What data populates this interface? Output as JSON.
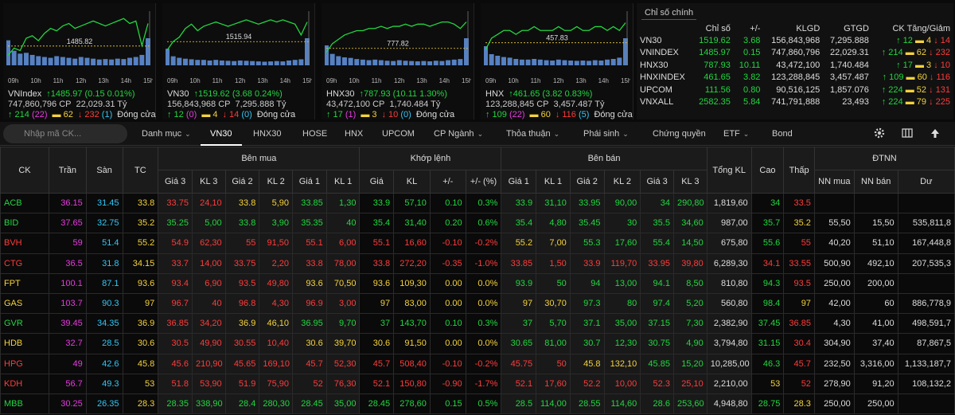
{
  "colors": {
    "up": "#22d640",
    "down": "#ff3b3b",
    "ref": "#f4d23c",
    "ceil": "#e63be0",
    "floor": "#34c6f4"
  },
  "charts": [
    {
      "name": "VNIndex",
      "ref_value": "1485.82",
      "times": [
        "09h",
        "10h",
        "11h",
        "12h",
        "13h",
        "14h",
        "15h"
      ],
      "line": [
        1482,
        1485,
        1484,
        1489,
        1490,
        1488,
        1491,
        1493,
        1492,
        1494,
        1495,
        1493,
        1494,
        1495,
        1496,
        1495,
        1494,
        1495,
        1496,
        1497,
        1495,
        1496,
        1486,
        1495
      ],
      "volume": [
        60,
        35,
        28,
        30,
        25,
        22,
        20,
        18,
        22,
        20,
        18,
        16,
        20,
        18,
        16,
        14,
        15,
        14,
        16,
        15,
        18,
        20,
        25,
        65
      ],
      "ylim": [
        1478,
        1500
      ],
      "value": "1485.97",
      "change": "(0.15 0.01%)",
      "dir": "up",
      "vol": "747,860,796 CP",
      "val": "22,029.31 Tỷ",
      "adv": "214",
      "adv_c": "(22)",
      "unch": "62",
      "dec": "232",
      "dec_f": "(1)",
      "status": "Đóng cửa"
    },
    {
      "name": "VN30",
      "ref_value": "1515.94",
      "times": [
        "09h",
        "10h",
        "11h",
        "12h",
        "13h",
        "14h",
        "15h"
      ],
      "line": [
        1512,
        1516,
        1518,
        1522,
        1524,
        1521,
        1523,
        1524,
        1525,
        1524,
        1523,
        1524,
        1525,
        1526,
        1525,
        1524,
        1525,
        1526,
        1525,
        1526,
        1525,
        1524,
        1519,
        1525
      ],
      "volume": [
        55,
        30,
        25,
        22,
        20,
        18,
        18,
        16,
        18,
        16,
        15,
        14,
        16,
        15,
        14,
        13,
        12,
        13,
        14,
        13,
        16,
        18,
        20,
        90
      ],
      "ylim": [
        1505,
        1530
      ],
      "value": "1519.62",
      "change": "(3.68 0.24%)",
      "dir": "up",
      "vol": "156,843,968 CP",
      "val": "7,295.888 Tỷ",
      "adv": "12",
      "adv_c": "(0)",
      "unch": "4",
      "dec": "14",
      "dec_f": "(0)",
      "status": "Đóng cửa"
    },
    {
      "name": "HNX30",
      "ref_value": "777.82",
      "times": [
        "09h",
        "10h",
        "11h",
        "12h",
        "13h",
        "14h",
        "15h"
      ],
      "line": [
        776,
        780,
        782,
        784,
        785,
        786,
        786,
        787,
        787,
        788,
        787,
        788,
        788,
        789,
        788,
        789,
        789,
        788,
        789,
        790,
        790,
        789,
        787,
        790
      ],
      "volume": [
        70,
        40,
        32,
        28,
        26,
        22,
        20,
        18,
        20,
        18,
        16,
        15,
        18,
        16,
        15,
        14,
        15,
        14,
        16,
        15,
        18,
        20,
        22,
        95
      ],
      "ylim": [
        770,
        795
      ],
      "value": "787.93",
      "change": "(10.11 1.30%)",
      "dir": "up",
      "vol": "43,472,100 CP",
      "val": "1,740.484 Tỷ",
      "adv": "17",
      "adv_c": "(1)",
      "unch": "3",
      "dec": "10",
      "dec_f": "(0)",
      "status": "Đóng cửa"
    },
    {
      "name": "HNX",
      "ref_value": "457.83",
      "times": [
        "09h",
        "10h",
        "11h",
        "12h",
        "13h",
        "14h",
        "15h"
      ],
      "line": [
        456,
        459,
        460,
        461,
        461,
        460,
        461,
        461,
        462,
        461,
        461,
        461,
        462,
        461,
        461,
        462,
        461,
        461,
        462,
        462,
        461,
        462,
        461,
        463
      ],
      "volume": [
        60,
        35,
        30,
        26,
        24,
        20,
        18,
        18,
        20,
        18,
        16,
        15,
        18,
        16,
        15,
        14,
        15,
        14,
        16,
        15,
        18,
        20,
        24,
        85
      ],
      "ylim": [
        452,
        466
      ],
      "value": "461.65",
      "change": "(3.82 0.83%)",
      "dir": "up",
      "vol": "123,288,845 CP",
      "val": "3,457.487 Tỷ",
      "adv": "109",
      "adv_c": "(22)",
      "unch": "60",
      "dec": "116",
      "dec_f": "(5)",
      "status": "Đóng cửa"
    }
  ],
  "summary": {
    "title": "Chỉ số chính",
    "headers": [
      "Chỉ số",
      "+/-",
      "KLGD",
      "GTGD",
      "CK Tăng/Giảm"
    ],
    "rows": [
      {
        "name": "VN30",
        "value": "1519.62",
        "chg": "3.68",
        "vol": "156,843,968",
        "val": "7,295.888",
        "up": "12",
        "ref": "4",
        "down": "14"
      },
      {
        "name": "VNINDEX",
        "value": "1485.97",
        "chg": "0.15",
        "vol": "747,860,796",
        "val": "22,029.31",
        "up": "214",
        "ref": "62",
        "down": "232"
      },
      {
        "name": "HNX30",
        "value": "787.93",
        "chg": "10.11",
        "vol": "43,472,100",
        "val": "1,740.484",
        "up": "17",
        "ref": "3",
        "down": "10"
      },
      {
        "name": "HNXINDEX",
        "value": "461.65",
        "chg": "3.82",
        "vol": "123,288,845",
        "val": "3,457.487",
        "up": "109",
        "ref": "60",
        "down": "116"
      },
      {
        "name": "UPCOM",
        "value": "111.56",
        "chg": "0.80",
        "vol": "90,516,125",
        "val": "1,857.076",
        "up": "224",
        "ref": "52",
        "down": "131"
      },
      {
        "name": "VNXALL",
        "value": "2582.35",
        "chg": "5.84",
        "vol": "741,791,888",
        "val": "23,493",
        "up": "224",
        "ref": "79",
        "down": "225"
      }
    ]
  },
  "toolbar": {
    "search_placeholder": "Nhập mã CK...",
    "tabs": [
      {
        "label": "Danh mục",
        "caret": true
      },
      {
        "label": "VN30",
        "caret": false,
        "active": true
      },
      {
        "label": "HNX30",
        "caret": false
      },
      {
        "label": "HOSE",
        "caret": false
      },
      {
        "label": "HNX",
        "caret": false
      },
      {
        "label": "UPCOM",
        "caret": false
      },
      {
        "label": "CP Ngành",
        "caret": true
      },
      {
        "label": "Thỏa thuận",
        "caret": true
      },
      {
        "label": "Phái sinh",
        "caret": true
      },
      {
        "label": "Chứng quyền",
        "caret": false
      },
      {
        "label": "ETF",
        "caret": true
      },
      {
        "label": "Bond",
        "caret": false
      }
    ]
  },
  "grid": {
    "group_headers": {
      "ck": "CK",
      "tran": "Trần",
      "san": "Sàn",
      "tc": "TC",
      "buy": "Bên mua",
      "match": "Khớp lệnh",
      "sell": "Bên bán",
      "total": "Tổng KL",
      "high": "Cao",
      "low": "Thấp",
      "foreign": "ĐTNN"
    },
    "sub_headers": [
      "Giá 3",
      "KL 3",
      "Giá 2",
      "KL 2",
      "Giá 1",
      "KL 1",
      "Giá",
      "KL",
      "+/-",
      "+/- (%)",
      "Giá 1",
      "KL 1",
      "Giá 2",
      "KL 2",
      "Giá 3",
      "KL 3",
      "NN mua",
      "NN bán",
      "Dư"
    ],
    "rows": [
      {
        "ck": "ACB",
        "tran": "36.15",
        "san": "31.45",
        "tc": "33.8",
        "b3": "33.75",
        "bk3": "24,10",
        "b2": "33.8",
        "bk2": "5,90",
        "b1": "33.85",
        "bk1": "1,30",
        "p": "33.9",
        "kl": "57,10",
        "ch": "0.10",
        "pc": "0.3%",
        "s1": "33.9",
        "sk1": "31,10",
        "s2": "33.95",
        "sk2": "90,00",
        "s3": "34",
        "sk3": "290,80",
        "tot": "1,819,60",
        "hi": "34",
        "lo": "33.5",
        "nm": "",
        "nb": "",
        "du": "",
        "c": {
          "ck": "g",
          "b3": "r",
          "b2": "y",
          "b1": "g",
          "p": "g",
          "s1": "g",
          "s2": "g",
          "s3": "g",
          "hi": "g",
          "lo": "r"
        }
      },
      {
        "ck": "BID",
        "tran": "37.65",
        "san": "32.75",
        "tc": "35.2",
        "b3": "35.25",
        "bk3": "5,00",
        "b2": "33.8",
        "bk2": "3,90",
        "b1": "35.35",
        "bk1": "40",
        "p": "35.4",
        "kl": "31,40",
        "ch": "0.20",
        "pc": "0.6%",
        "s1": "35.4",
        "sk1": "4,80",
        "s2": "35.45",
        "sk2": "30",
        "s3": "35.5",
        "sk3": "34,60",
        "tot": "987,00",
        "hi": "35.7",
        "lo": "35.2",
        "nm": "55,50",
        "nb": "15,50",
        "du": "535,811,8",
        "c": {
          "ck": "g",
          "b3": "g",
          "b2": "g",
          "b1": "g",
          "p": "g",
          "s1": "g",
          "s2": "g",
          "s3": "g",
          "hi": "g",
          "lo": "y"
        }
      },
      {
        "ck": "BVH",
        "tran": "59",
        "san": "51.4",
        "tc": "55.2",
        "b3": "54.9",
        "bk3": "62,30",
        "b2": "55",
        "bk2": "91,50",
        "b1": "55.1",
        "bk1": "6,00",
        "p": "55.1",
        "kl": "16,60",
        "ch": "-0.10",
        "pc": "-0.2%",
        "s1": "55.2",
        "sk1": "7,00",
        "s2": "55.3",
        "sk2": "17,60",
        "s3": "55.4",
        "sk3": "14,50",
        "tot": "675,80",
        "hi": "55.6",
        "lo": "55",
        "nm": "40,20",
        "nb": "51,10",
        "du": "167,448,8",
        "c": {
          "ck": "r",
          "b3": "r",
          "b2": "r",
          "b1": "r",
          "p": "r",
          "s1": "y",
          "s2": "g",
          "s3": "g",
          "hi": "g",
          "lo": "r"
        }
      },
      {
        "ck": "CTG",
        "tran": "36.5",
        "san": "31.8",
        "tc": "34.15",
        "b3": "33.7",
        "bk3": "14,00",
        "b2": "33.75",
        "bk2": "2,20",
        "b1": "33.8",
        "bk1": "78,00",
        "p": "33.8",
        "kl": "272,20",
        "ch": "-0.35",
        "pc": "-1.0%",
        "s1": "33.85",
        "sk1": "1,50",
        "s2": "33.9",
        "sk2": "119,70",
        "s3": "33.95",
        "sk3": "39,80",
        "tot": "6,289,30",
        "hi": "34.1",
        "lo": "33.55",
        "nm": "500,90",
        "nb": "492,10",
        "du": "207,535,3",
        "c": {
          "ck": "r",
          "b3": "r",
          "b2": "r",
          "b1": "r",
          "p": "r",
          "s1": "r",
          "s2": "r",
          "s3": "r",
          "hi": "r",
          "lo": "r"
        }
      },
      {
        "ck": "FPT",
        "tran": "100.1",
        "san": "87.1",
        "tc": "93.6",
        "b3": "93.4",
        "bk3": "6,90",
        "b2": "93.5",
        "bk2": "49,80",
        "b1": "93.6",
        "bk1": "70,50",
        "p": "93.6",
        "kl": "109,30",
        "ch": "0.00",
        "pc": "0.0%",
        "s1": "93.9",
        "sk1": "50",
        "s2": "94",
        "sk2": "13,00",
        "s3": "94.1",
        "sk3": "8,50",
        "tot": "810,80",
        "hi": "94.3",
        "lo": "93.5",
        "nm": "250,00",
        "nb": "200,00",
        "du": "",
        "c": {
          "ck": "y",
          "b3": "r",
          "b2": "r",
          "b1": "y",
          "p": "y",
          "s1": "g",
          "s2": "g",
          "s3": "g",
          "hi": "g",
          "lo": "r"
        }
      },
      {
        "ck": "GAS",
        "tran": "103.7",
        "san": "90.3",
        "tc": "97",
        "b3": "96.7",
        "bk3": "40",
        "b2": "96.8",
        "bk2": "4,30",
        "b1": "96.9",
        "bk1": "3,00",
        "p": "97",
        "kl": "83,00",
        "ch": "0.00",
        "pc": "0.0%",
        "s1": "97",
        "sk1": "30,70",
        "s2": "97.3",
        "sk2": "80",
        "s3": "97.4",
        "sk3": "5,20",
        "tot": "560,80",
        "hi": "98.4",
        "lo": "97",
        "nm": "42,00",
        "nb": "60",
        "du": "886,778,9",
        "c": {
          "ck": "y",
          "b3": "r",
          "b2": "r",
          "b1": "r",
          "p": "y",
          "s1": "y",
          "s2": "g",
          "s3": "g",
          "hi": "g",
          "lo": "y"
        }
      },
      {
        "ck": "GVR",
        "tran": "39.45",
        "san": "34.35",
        "tc": "36.9",
        "b3": "36.85",
        "bk3": "34,20",
        "b2": "36.9",
        "bk2": "46,10",
        "b1": "36.95",
        "bk1": "9,70",
        "p": "37",
        "kl": "143,70",
        "ch": "0.10",
        "pc": "0.3%",
        "s1": "37",
        "sk1": "5,70",
        "s2": "37.1",
        "sk2": "35,00",
        "s3": "37.15",
        "sk3": "7,30",
        "tot": "2,382,90",
        "hi": "37.45",
        "lo": "36.85",
        "nm": "4,30",
        "nb": "41,00",
        "du": "498,591,7",
        "c": {
          "ck": "g",
          "b3": "r",
          "b2": "y",
          "b1": "g",
          "p": "g",
          "s1": "g",
          "s2": "g",
          "s3": "g",
          "hi": "g",
          "lo": "r"
        }
      },
      {
        "ck": "HDB",
        "tran": "32.7",
        "san": "28.5",
        "tc": "30.6",
        "b3": "30.5",
        "bk3": "49,90",
        "b2": "30.55",
        "bk2": "10,40",
        "b1": "30.6",
        "bk1": "39,70",
        "p": "30.6",
        "kl": "91,50",
        "ch": "0.00",
        "pc": "0.0%",
        "s1": "30.65",
        "sk1": "81,00",
        "s2": "30.7",
        "sk2": "12,30",
        "s3": "30.75",
        "sk3": "4,90",
        "tot": "3,794,80",
        "hi": "31.15",
        "lo": "30.4",
        "nm": "304,90",
        "nb": "37,40",
        "du": "87,867,5",
        "c": {
          "ck": "y",
          "b3": "r",
          "b2": "r",
          "b1": "y",
          "p": "y",
          "s1": "g",
          "s2": "g",
          "s3": "g",
          "hi": "g",
          "lo": "r"
        }
      },
      {
        "ck": "HPG",
        "tran": "49",
        "san": "42.6",
        "tc": "45.8",
        "b3": "45.6",
        "bk3": "210,90",
        "b2": "45.65",
        "bk2": "169,10",
        "b1": "45.7",
        "bk1": "52,30",
        "p": "45.7",
        "kl": "508,40",
        "ch": "-0.10",
        "pc": "-0.2%",
        "s1": "45.75",
        "sk1": "50",
        "s2": "45.8",
        "sk2": "132,10",
        "s3": "45.85",
        "sk3": "15,20",
        "tot": "10,285,00",
        "hi": "46.3",
        "lo": "45.7",
        "nm": "232,50",
        "nb": "3,316,00",
        "du": "1,133,187,7",
        "c": {
          "ck": "r",
          "b3": "r",
          "b2": "r",
          "b1": "r",
          "p": "r",
          "s1": "r",
          "s2": "y",
          "s3": "g",
          "hi": "g",
          "lo": "r"
        }
      },
      {
        "ck": "KDH",
        "tran": "56.7",
        "san": "49.3",
        "tc": "53",
        "b3": "51.8",
        "bk3": "53,90",
        "b2": "51.9",
        "bk2": "75,90",
        "b1": "52",
        "bk1": "76,30",
        "p": "52.1",
        "kl": "150,80",
        "ch": "-0.90",
        "pc": "-1.7%",
        "s1": "52.1",
        "sk1": "17,60",
        "s2": "52.2",
        "sk2": "10,00",
        "s3": "52.3",
        "sk3": "25,10",
        "tot": "2,210,00",
        "hi": "53",
        "lo": "52",
        "nm": "278,90",
        "nb": "91,20",
        "du": "108,132,2",
        "c": {
          "ck": "r",
          "b3": "r",
          "b2": "r",
          "b1": "r",
          "p": "r",
          "s1": "r",
          "s2": "r",
          "s3": "r",
          "hi": "y",
          "lo": "r"
        }
      },
      {
        "ck": "MBB",
        "tran": "30.25",
        "san": "26.35",
        "tc": "28.3",
        "b3": "28.35",
        "bk3": "338,90",
        "b2": "28.4",
        "bk2": "280,30",
        "b1": "28.45",
        "bk1": "35,00",
        "p": "28.45",
        "kl": "278,60",
        "ch": "0.15",
        "pc": "0.5%",
        "s1": "28.5",
        "sk1": "114,00",
        "s2": "28.55",
        "sk2": "114,60",
        "s3": "28.6",
        "sk3": "253,60",
        "tot": "4,948,80",
        "hi": "28.75",
        "lo": "28.3",
        "nm": "250,00",
        "nb": "250,00",
        "du": "",
        "c": {
          "ck": "g",
          "b3": "g",
          "b2": "g",
          "b1": "g",
          "p": "g",
          "s1": "g",
          "s2": "g",
          "s3": "g",
          "hi": "g",
          "lo": "y"
        }
      }
    ]
  }
}
